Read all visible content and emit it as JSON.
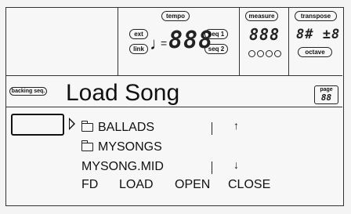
{
  "header": {
    "tempo_label": "tempo",
    "ext_label": "ext",
    "link_label": "link",
    "tempo_value": "888",
    "seq1_label": "seq 1",
    "seq2_label": "seq 2",
    "measure_label": "measure",
    "measure_value": "888",
    "transpose_label": "transpose",
    "transpose_value": "8#  ±8",
    "octave_label": "octave"
  },
  "mode_badge": "backing seq.",
  "title": "Load Song",
  "page_label": "page",
  "page_value": "88",
  "list": {
    "items": [
      {
        "type": "folder",
        "label": "BALLADS"
      },
      {
        "type": "folder",
        "label": "MYSONGS"
      },
      {
        "type": "file",
        "label": "MYSONG.MID"
      }
    ],
    "scroll_up": "↑",
    "scroll_down": "↓"
  },
  "softkeys": [
    "FD",
    "LOAD",
    "OPEN",
    "CLOSE"
  ]
}
